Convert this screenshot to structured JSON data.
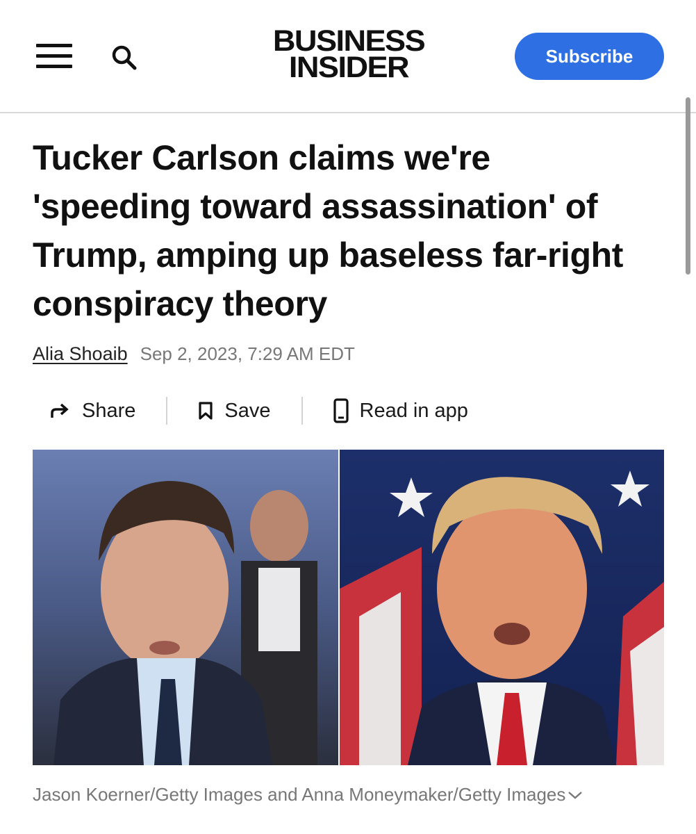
{
  "header": {
    "logo_line1": "BUSINESS",
    "logo_line2": "INSIDER",
    "subscribe_label": "Subscribe",
    "menu_icon": "hamburger-menu-icon",
    "search_icon": "search-icon",
    "accent_color": "#2f6fe4"
  },
  "article": {
    "headline": "Tucker Carlson claims we're 'speeding toward assassination' of Trump, amping up baseless far-right conspiracy theory",
    "author": "Alia Shoaib",
    "date": "Sep 2, 2023, 7:29 AM EDT"
  },
  "actions": {
    "share_label": "Share",
    "save_label": "Save",
    "read_in_app_label": "Read in app"
  },
  "image": {
    "caption": "Jason Koerner/Getty Images and Anna Moneymaker/Getty Images"
  }
}
